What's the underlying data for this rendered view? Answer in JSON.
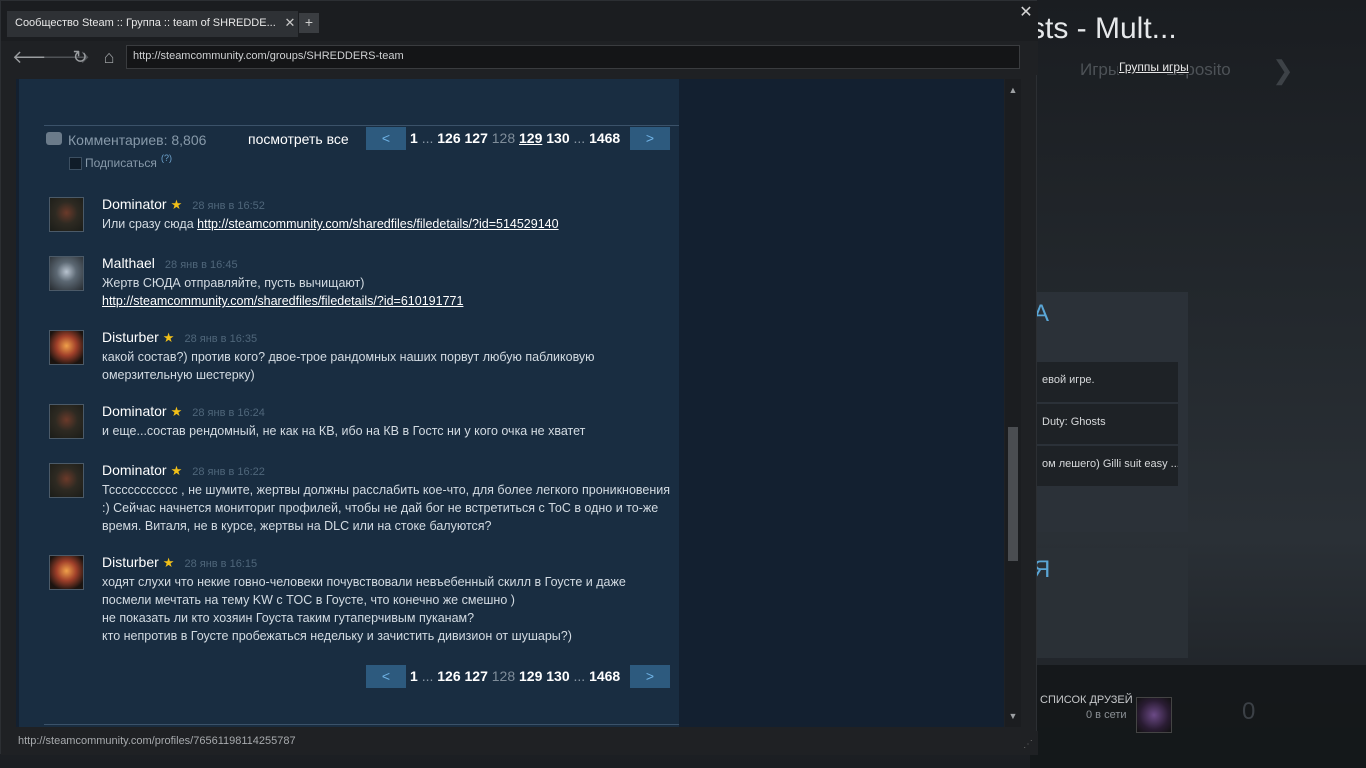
{
  "background": {
    "title": "sts - Mult...",
    "nav_faded": "Игры",
    "nav_faded2": "Esposito",
    "groups_link": "Группы игры",
    "panel_accent": "A",
    "rows": [
      "евой игре.",
      "Duty: Ghosts",
      "ом лешего) Gilli suit easy ..."
    ],
    "panel2_accent": "Я",
    "friends_label": "СПИСОК ДРУЗЕЙ",
    "online_label": "0 в сети",
    "counter": "0"
  },
  "browser": {
    "tab_title": "Сообщество Steam :: Группа :: team of SHREDDE...",
    "tab_close": "✕",
    "new_tab": "+",
    "window_close": "✕",
    "url": "http://steamcommunity.com/groups/SHREDDERS-team",
    "status_url": "http://steamcommunity.com/profiles/76561198114255787"
  },
  "comments_header": {
    "count_label": "Комментариев: 8,806",
    "view_all": "посмотреть все",
    "subscribe": "Подписаться",
    "help": "(?)"
  },
  "pager_top": {
    "prev": "<",
    "next": ">",
    "first": "1",
    "dots1": "...",
    "p126": "126",
    "p127": "127",
    "p128": "128",
    "p129": "129",
    "p130": "130",
    "dots2": "...",
    "last": "1468"
  },
  "pager_bottom": {
    "prev": "<",
    "next": ">",
    "first": "1",
    "dots1": "...",
    "p126": "126",
    "p127": "127",
    "p128": "128",
    "p129": "129",
    "p130": "130",
    "dots2": "...",
    "last": "1468"
  },
  "comments": [
    {
      "author": "Dominator",
      "star": "★",
      "time": "28 янв в 16:52",
      "text_prefix": "Или сразу сюда ",
      "link": "http://steamcommunity.com/sharedfiles/filedetails/?id=514529140"
    },
    {
      "author": "Malthael",
      "time": "28 янв в 16:45",
      "line1": "Жертв СЮДА отправляйте, пусть вычищают)",
      "link": "http://steamcommunity.com/sharedfiles/filedetails/?id=610191771"
    },
    {
      "author": "Disturber",
      "star": "★",
      "time": "28 янв в 16:35",
      "text": "какой состав?) против кого? двое-трое рандомных наших порвут любую пабликовую омерзительную шестерку)"
    },
    {
      "author": "Dominator",
      "star": "★",
      "time": "28 янв в 16:24",
      "text": "и еще...состав рендомный, не как на КВ, ибо на КВ в Гостс ни у кого очка не хватет"
    },
    {
      "author": "Dominator",
      "star": "★",
      "time": "28 янв в 16:22",
      "text": "Тссссссссссс , не шумите, жертвы должны расслабить кое-что, для более легкого проникновения :) Сейчас начнется мониториг профилей, чтобы не дай бог не встретиться с ТоС в одно и то-же время. Виталя, не в курсе, жертвы на DLC или на стоке балуются?"
    },
    {
      "author": "Disturber",
      "star": "★",
      "time": "28 янв в 16:15",
      "line1": "ходят слухи что некие говно-человеки почувствовали невъебенный скилл в Гоусте и даже",
      "line2": "посмели мечтать на тему KW с TOC в Гоусте, что конечно же смешно )",
      "line3": "не показать ли кто хозяин Гоуста таким гутаперчивым пуканам?",
      "line4": "кто непротив в Гоусте пробежаться недельку и зачистить дивизион от шушары?)"
    }
  ]
}
